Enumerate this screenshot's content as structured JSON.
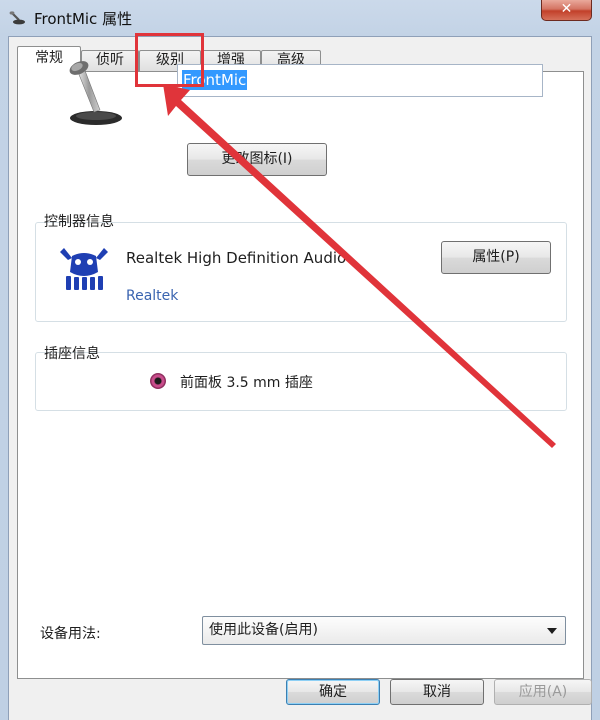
{
  "window": {
    "title": "FrontMic 属性",
    "close_label": "✕"
  },
  "tabs": [
    {
      "label": "常规",
      "active": true
    },
    {
      "label": "侦听",
      "active": false
    },
    {
      "label": "级别",
      "active": false
    },
    {
      "label": "增强",
      "active": false
    },
    {
      "label": "高级",
      "active": false
    }
  ],
  "general": {
    "device_name_value": "FrontMic",
    "change_icon_label": "更改图标(I)"
  },
  "controller": {
    "group_label": "控制器信息",
    "device_name": "Realtek High Definition Audio",
    "vendor": "Realtek",
    "properties_label": "属性(P)"
  },
  "jack": {
    "group_label": "插座信息",
    "description": "前面板 3.5 mm 插座",
    "jack_color": "#c94d8c"
  },
  "usage": {
    "label": "设备用法:",
    "selected": "使用此设备(启用)"
  },
  "footer": {
    "ok_label": "确定",
    "cancel_label": "取消",
    "apply_label": "应用(A)"
  },
  "annotation": {
    "color": "#e0343a",
    "target": "级别"
  },
  "icons": {
    "title": "microphone-icon",
    "device": "microphone-icon",
    "vendor": "realtek-crab-logo"
  }
}
